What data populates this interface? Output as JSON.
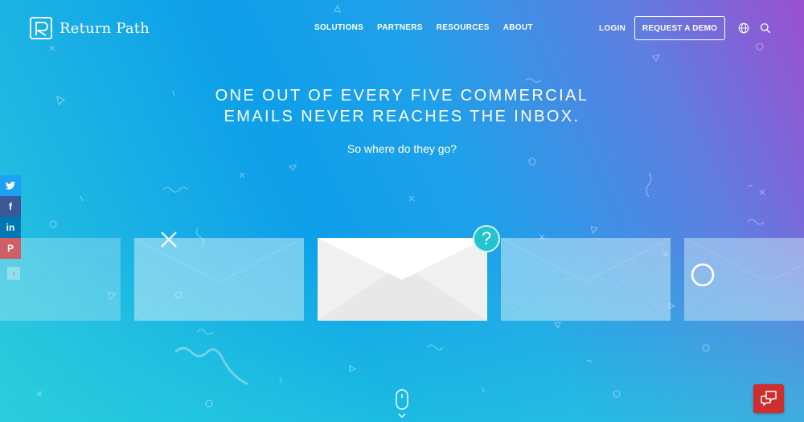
{
  "brand": {
    "name": "Return Path"
  },
  "nav": {
    "items": [
      {
        "label": "SOLUTIONS"
      },
      {
        "label": "PARTNERS"
      },
      {
        "label": "RESOURCES"
      },
      {
        "label": "ABOUT"
      }
    ],
    "login": "LOGIN",
    "demo": "REQUEST A DEMO",
    "icons": [
      "globe-icon",
      "search-icon"
    ]
  },
  "hero": {
    "title_line1": "ONE OUT OF EVERY FIVE COMMERCIAL",
    "title_line2": "EMAILS NEVER REACHES THE INBOX.",
    "subtitle": "So where do they go?"
  },
  "social": {
    "items": [
      {
        "name": "twitter",
        "glyph": "🐦",
        "color": "#1da1f2"
      },
      {
        "name": "facebook",
        "glyph": "f",
        "color": "#3b5998"
      },
      {
        "name": "linkedin",
        "glyph": "in",
        "color": "#0077b5"
      },
      {
        "name": "pinterest",
        "glyph": "P",
        "color": "#cb2027"
      }
    ],
    "collapse_glyph": "‹"
  },
  "envelopes": {
    "question_mark": "?",
    "marks": [
      "close-icon",
      "question-icon",
      "circle-icon"
    ]
  },
  "colors": {
    "gradient_top_right": "#9b4fd0",
    "gradient_mid": "#1fa0ea",
    "gradient_bottom": "#2ec8dc",
    "chat_button": "#cf2e2e",
    "question_badge": "#23c3cf"
  }
}
